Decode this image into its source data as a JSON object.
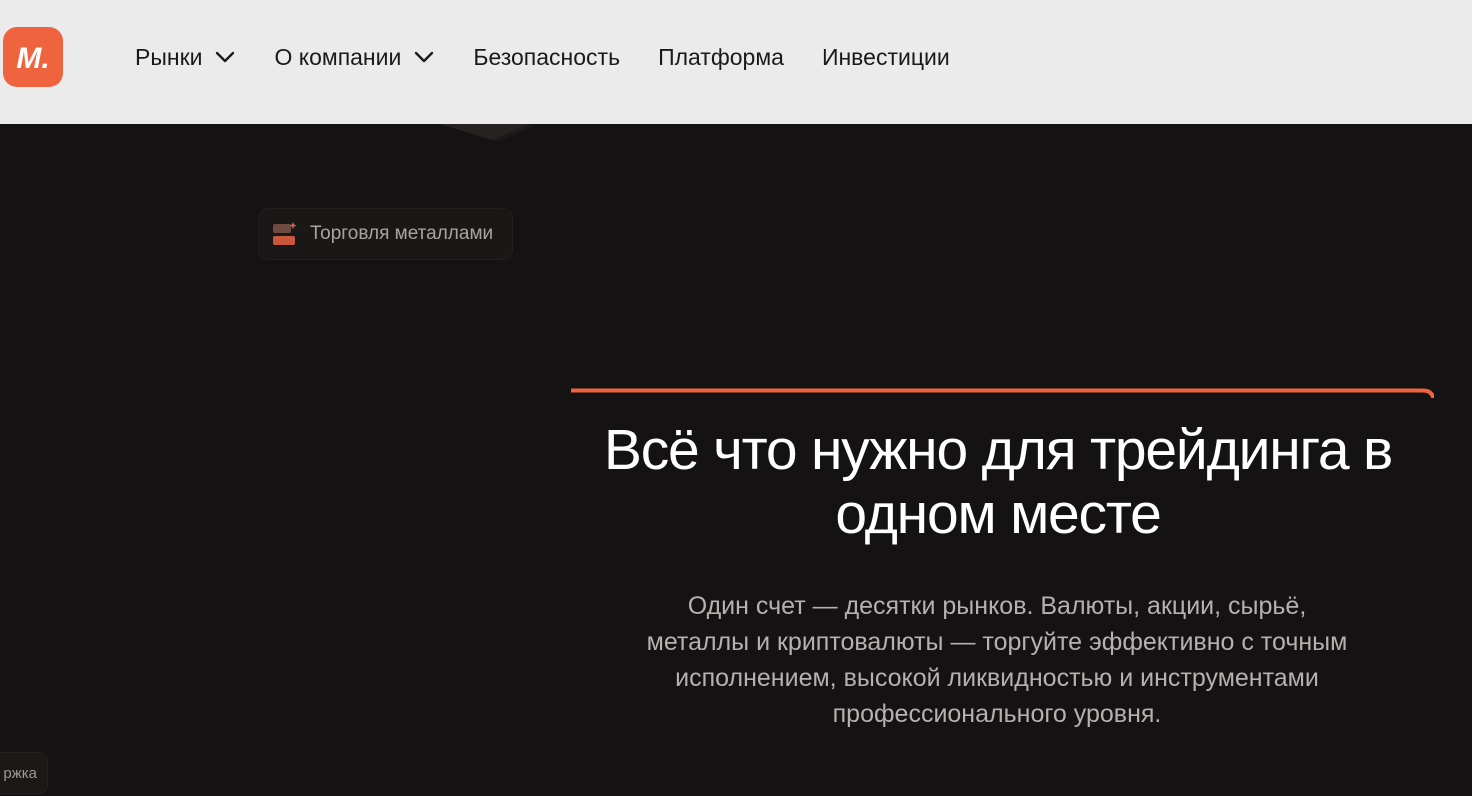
{
  "header": {
    "logo_text": "M.",
    "nav": [
      {
        "label": "Рынки",
        "has_dropdown": true
      },
      {
        "label": "О компании",
        "has_dropdown": true
      },
      {
        "label": "Безопасность",
        "has_dropdown": false
      },
      {
        "label": "Платформа",
        "has_dropdown": false
      },
      {
        "label": "Инвестиции",
        "has_dropdown": false
      }
    ]
  },
  "chip": {
    "label": "Торговля металлами",
    "icon": "metals-bars-icon"
  },
  "hero": {
    "title_line1": "Всё что нужно для трейдинга в",
    "title_line2": "одном месте",
    "subtitle_line1": "Один счет — десятки рынков. Валюты, акции, сырьё,",
    "subtitle_line2": "металлы и криптовалюты — торгуйте эффективно с точным",
    "subtitle_line3": "исполнением, высокой ликвидностью и инструментами",
    "subtitle_line4": "профессионального уровня."
  },
  "support": {
    "label": "ржка"
  },
  "colors": {
    "accent": "#f0633f",
    "background": "#141212",
    "header_bg": "#ebebeb"
  }
}
